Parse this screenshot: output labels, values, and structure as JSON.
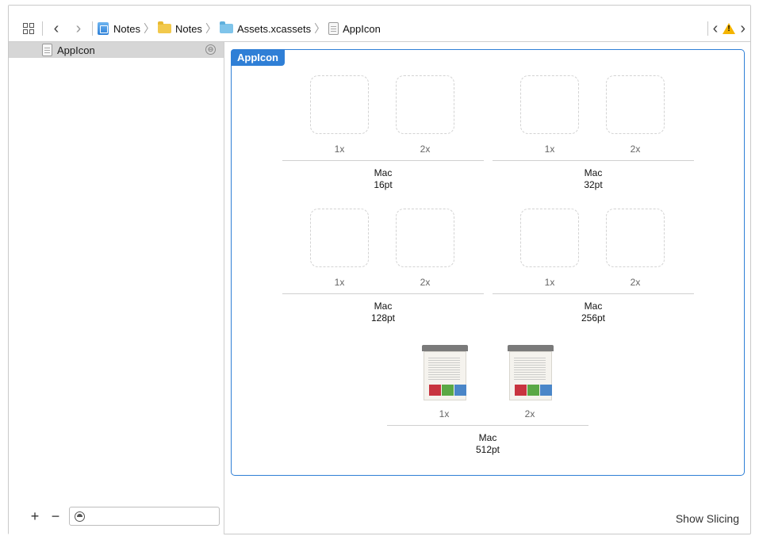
{
  "jumpbar": {
    "nav_back": "‹",
    "nav_forward": "›",
    "breadcrumbs": [
      {
        "label": "Notes",
        "icon": "project-icon"
      },
      {
        "label": "Notes",
        "icon": "folder-icon"
      },
      {
        "label": "Assets.xcassets",
        "icon": "asset-catalog-icon"
      },
      {
        "label": "AppIcon",
        "icon": "app-icon-set-icon"
      }
    ],
    "issue_prev": "‹",
    "issue_next": "›",
    "warning_glyph": "!"
  },
  "sidebar": {
    "items": [
      {
        "label": "AppIcon",
        "badge": "⊖"
      }
    ],
    "add_label": "+",
    "remove_label": "−",
    "filter_placeholder": ""
  },
  "editor": {
    "title": "AppIcon",
    "groups": [
      {
        "device": "Mac",
        "size": "16pt",
        "slots": [
          "1x",
          "2x"
        ],
        "filled": false
      },
      {
        "device": "Mac",
        "size": "32pt",
        "slots": [
          "1x",
          "2x"
        ],
        "filled": false
      },
      {
        "device": "Mac",
        "size": "128pt",
        "slots": [
          "1x",
          "2x"
        ],
        "filled": false
      },
      {
        "device": "Mac",
        "size": "256pt",
        "slots": [
          "1x",
          "2x"
        ],
        "filled": false
      },
      {
        "device": "Mac",
        "size": "512pt",
        "slots": [
          "1x",
          "2x"
        ],
        "filled": true
      }
    ],
    "show_slicing": "Show Slicing"
  },
  "colors": {
    "accent": "#2f7fd6",
    "selection": "#d6d6d6",
    "warning": "#f4b400",
    "swatch_red": "#c8343f",
    "swatch_green": "#5aa845",
    "swatch_blue": "#4a86c8"
  }
}
